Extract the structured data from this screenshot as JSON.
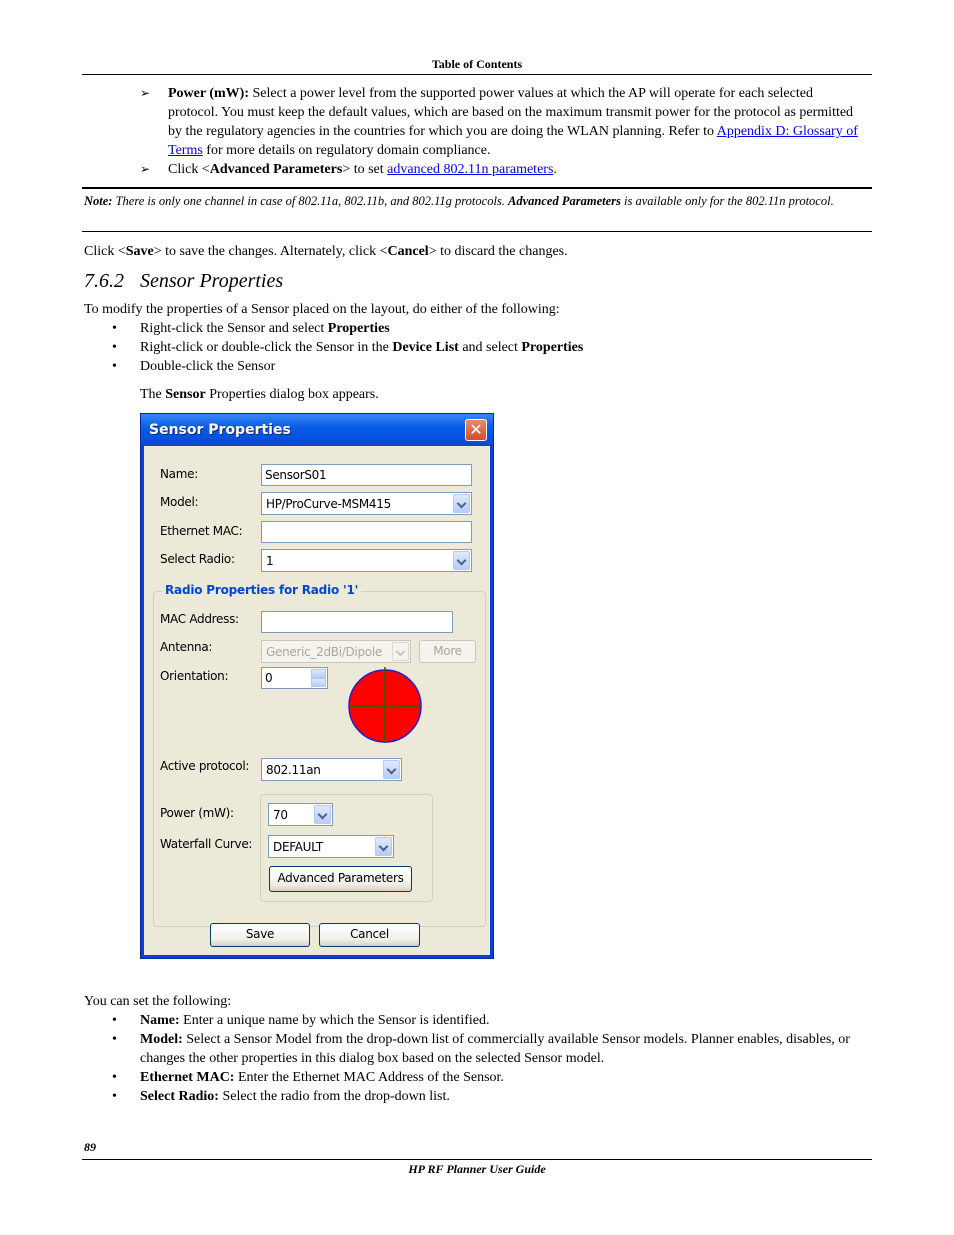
{
  "header": {
    "title": "Table of Contents"
  },
  "top_items": [
    {
      "bold": "Power (mW):",
      "text": " Select a power level from the supported power values at which the AP will operate for each selected protocol. You must keep the default values, which are based on the maximum transmit power for the protocol as permitted by the regulatory agencies in the countries for which you are doing the WLAN planning. Refer to ",
      "link": "Appendix D: Glossary of Terms",
      "after": " for more details on regulatory domain compliance."
    },
    {
      "pre": "Click <",
      "bold": "Advanced Parameters",
      "mid": "> to set ",
      "link": "advanced 802.11n parameters",
      "after": "."
    }
  ],
  "note": {
    "label": "Note:",
    "text1": " There is only one channel in case of 802.11a, 802.11b, and 802.11g protocols. ",
    "bold": "Advanced Parameters",
    "text2": " is available only for the 802.11n protocol."
  },
  "save_line": {
    "p1": "Click <",
    "b1": "Save",
    "p2": "> to save the changes. Alternately, click <",
    "b2": "Cancel",
    "p3": "> to discard the changes."
  },
  "section": {
    "number": "7.6.2",
    "title": "Sensor Properties"
  },
  "intro": "To modify the properties of a Sensor placed on the layout, do either of the following:",
  "ways": [
    {
      "text": "Right-click the Sensor and select ",
      "bold": "Properties",
      "text2": "",
      "bold2": ""
    },
    {
      "text": "Right-click or double-click the Sensor in the ",
      "bold": "Device List",
      "text2": " and select ",
      "bold2": "Properties"
    },
    {
      "text": "Double-click the Sensor",
      "bold": "",
      "text2": "",
      "bold2": ""
    }
  ],
  "dialog_intro": {
    "p1": "The ",
    "b": "Sensor",
    "p2": " Properties dialog box appears."
  },
  "dialog": {
    "title": "Sensor Properties",
    "close_icon": "close-icon",
    "fields": {
      "name_label": "Name:",
      "name_value": "SensorS01",
      "model_label": "Model:",
      "model_value": "HP/ProCurve-MSM415",
      "ethernet_mac_label": "Ethernet MAC:",
      "ethernet_mac_value": "",
      "select_radio_label": "Select Radio:",
      "select_radio_value": "1"
    },
    "radio_group": {
      "title": "Radio Properties for Radio '1'",
      "mac_label": "MAC Address:",
      "mac_value": "",
      "antenna_label": "Antenna:",
      "antenna_value": "Generic_2dBi/Dipole",
      "more_button": "More",
      "orientation_label": "Orientation:",
      "orientation_value": "0",
      "antenna_pattern_colors": {
        "fill": "#ff0000",
        "outline": "#2020d0",
        "crosshair": "#1a6a00"
      },
      "active_protocol_label": "Active protocol:",
      "active_protocol_value": "802.11an",
      "power_label": "Power (mW):",
      "power_value": "70",
      "waterfall_label": "Waterfall Curve:",
      "waterfall_value": "DEFAULT",
      "advanced_button": "Advanced Parameters"
    },
    "save_button": "Save",
    "cancel_button": "Cancel"
  },
  "set_intro": "You can set the following:",
  "set_items": [
    {
      "bold": "Name:",
      "text": " Enter a unique name by which the Sensor is identified."
    },
    {
      "bold": "Model:",
      "text": " Select a Sensor Model from the drop-down list of commercially available Sensor models. Planner enables, disables, or changes the other properties in this dialog box based on the selected Sensor model."
    },
    {
      "bold": "Ethernet MAC:",
      "text": " Enter the Ethernet MAC Address of the Sensor."
    },
    {
      "bold": "Select Radio:",
      "text": " Select the radio from the drop-down list."
    }
  ],
  "footer": {
    "page_number": "89",
    "title": "HP RF Planner User Guide"
  }
}
